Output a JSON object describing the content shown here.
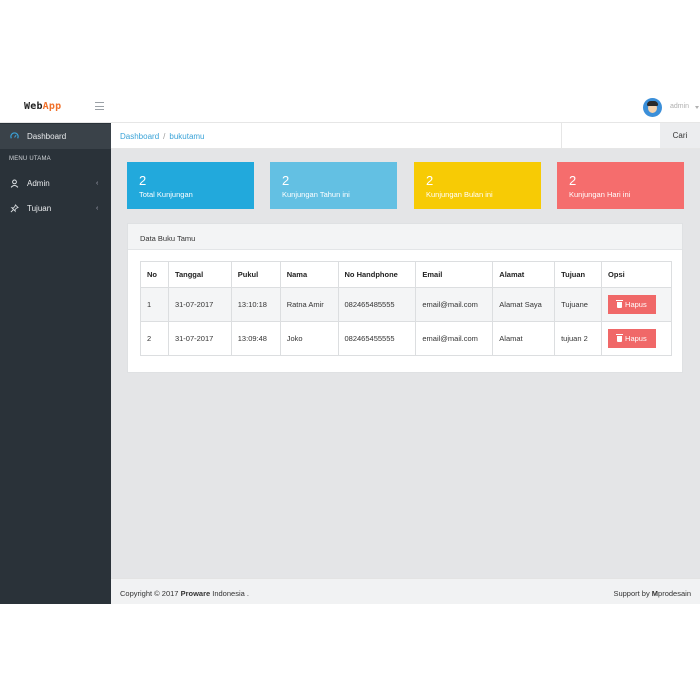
{
  "app": {
    "brand_main": "Web",
    "brand_accent": "App",
    "user": "admin",
    "accent_color": "#f0702a"
  },
  "sidebar": {
    "dashboard": "Dashboard",
    "menu_header": "MENU UTAMA",
    "admin": "Admin",
    "tujuan": "Tujuan",
    "caret": "‹"
  },
  "breadcrumb": {
    "home": "Dashboard",
    "sep": "/",
    "current": "bukutamu"
  },
  "search": {
    "placeholder": "",
    "button": "Cari"
  },
  "stats": [
    {
      "value": "2",
      "label": "Total Kunjungan",
      "color": "#22a9dc"
    },
    {
      "value": "2",
      "label": "Kunjungan Tahun ini",
      "color": "#63c0e3"
    },
    {
      "value": "2",
      "label": "Kunjungan Bulan ini",
      "color": "#f7cb05"
    },
    {
      "value": "2",
      "label": "Kunjungan Hari ini",
      "color": "#f56d6d"
    }
  ],
  "panel": {
    "title": "Data Buku Tamu"
  },
  "table": {
    "headers": [
      "No",
      "Tanggal",
      "Pukul",
      "Nama",
      "No Handphone",
      "Email",
      "Alamat",
      "Tujuan",
      "Opsi"
    ],
    "rows": [
      [
        "1",
        "31-07-2017",
        "13:10:18",
        "Ratna Amir",
        "082465485555",
        "email@mail.com",
        "Alamat Saya",
        "Tujuane"
      ],
      [
        "2",
        "31-07-2017",
        "13:09:48",
        "Joko",
        "082465455555",
        "email@mail.com",
        "Alamat",
        "tujuan 2"
      ]
    ],
    "delete_label": "Hapus"
  },
  "footer": {
    "copyright_prefix": "Copyright © 2017 ",
    "company": "Proware",
    "copyright_suffix": " Indonesia .",
    "support_prefix": "Support by ",
    "support_m": "M",
    "support_rest": "prodesain"
  }
}
